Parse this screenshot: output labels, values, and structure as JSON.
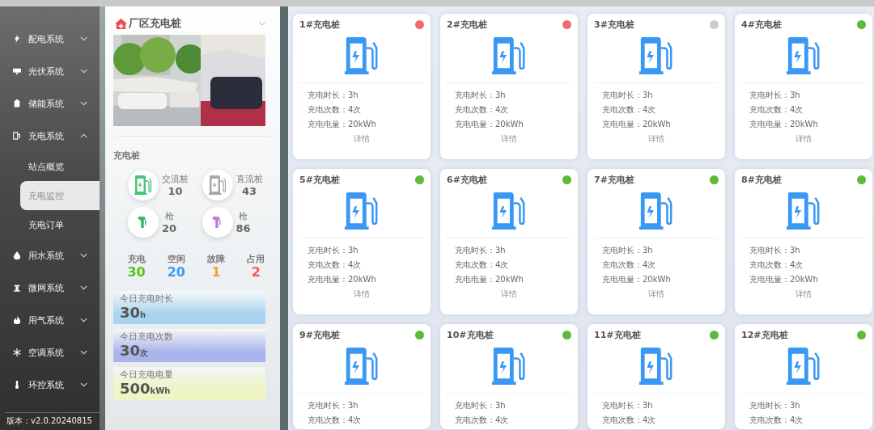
{
  "sidebar": {
    "items": [
      {
        "label": "配电系统",
        "expanded": false
      },
      {
        "label": "光伏系统",
        "expanded": false
      },
      {
        "label": "储能系统",
        "expanded": false
      },
      {
        "label": "充电系统",
        "expanded": true,
        "children": [
          {
            "label": "站点概览",
            "selected": false
          },
          {
            "label": "充电监控",
            "selected": true
          },
          {
            "label": "充电订单",
            "selected": false
          }
        ]
      },
      {
        "label": "用水系统",
        "expanded": false
      },
      {
        "label": "微网系统",
        "expanded": false
      },
      {
        "label": "用气系统",
        "expanded": false
      },
      {
        "label": "空调系统",
        "expanded": false
      },
      {
        "label": "环控系统",
        "expanded": false
      }
    ],
    "version": "版本：v2.0.20240815"
  },
  "station": {
    "title": "厂区充电桩",
    "section": "充电桩",
    "counts": [
      {
        "kind": "charger",
        "label": "交流桩",
        "value": "10",
        "color": "#4cc37a"
      },
      {
        "kind": "charger",
        "label": "直流桩",
        "value": "43",
        "color": "#a8a8a8"
      },
      {
        "kind": "gun",
        "label": "枪",
        "value": "20",
        "color": "#3fb36a"
      },
      {
        "kind": "gun",
        "label": "枪",
        "value": "86",
        "color": "#c27ad8"
      }
    ],
    "statuses": [
      {
        "label": "充电",
        "value": "30",
        "color": "#52c41a"
      },
      {
        "label": "空闲",
        "value": "20",
        "color": "#3a9cf5"
      },
      {
        "label": "故障",
        "value": "1",
        "color": "#f0a030"
      },
      {
        "label": "占用",
        "value": "2",
        "color": "#f05a5a"
      }
    ],
    "today": [
      {
        "label": "今日充电时长",
        "value": "30",
        "unit": "h",
        "color": "#a9d3ee"
      },
      {
        "label": "今日充电次数",
        "value": "30",
        "unit": "次",
        "color": "#aab4ec"
      },
      {
        "label": "今日充电电量",
        "value": "500",
        "unit": "kWh",
        "color": "#eef4c4"
      }
    ]
  },
  "chargers": [
    {
      "name": "1#充电桩",
      "color": "#f26b6b",
      "stats": [
        "充电时长：3h",
        "充电次数：4次",
        "充电电量：20kWh"
      ],
      "link": "详情"
    },
    {
      "name": "2#充电桩",
      "color": "#f26b6b",
      "stats": [
        "充电时长：3h",
        "充电次数：4次",
        "充电电量：20kWh"
      ],
      "link": "详情"
    },
    {
      "name": "3#充电桩",
      "color": "#cccccc",
      "stats": [
        "充电时长：3h",
        "充电次数：4次",
        "充电电量：20kWh"
      ],
      "link": "详情"
    },
    {
      "name": "4#充电桩",
      "color": "#5dbb3a",
      "stats": [
        "充电时长：3h",
        "充电次数：4次",
        "充电电量：20kWh"
      ],
      "link": "详情"
    },
    {
      "name": "5#充电桩",
      "color": "#5dbb3a",
      "stats": [
        "充电时长：3h",
        "充电次数：4次",
        "充电电量：20kWh"
      ],
      "link": "详情"
    },
    {
      "name": "6#充电桩",
      "color": "#5dbb3a",
      "stats": [
        "充电时长：3h",
        "充电次数：4次",
        "充电电量：20kWh"
      ],
      "link": "详情"
    },
    {
      "name": "7#充电桩",
      "color": "#5dbb3a",
      "stats": [
        "充电时长：3h",
        "充电次数：4次",
        "充电电量：20kWh"
      ],
      "link": "详情"
    },
    {
      "name": "8#充电桩",
      "color": "#5dbb3a",
      "stats": [
        "充电时长：3h",
        "充电次数：4次",
        "充电电量：20kWh"
      ],
      "link": "详情"
    },
    {
      "name": "9#充电桩",
      "color": "#5dbb3a",
      "stats": [
        "充电时长：3h",
        "充电次数：4次"
      ]
    },
    {
      "name": "10#充电桩",
      "color": "#5dbb3a",
      "stats": [
        "充电时长：3h",
        "充电次数：4次"
      ]
    },
    {
      "name": "11#充电桩",
      "color": "#5dbb3a",
      "stats": [
        "充电时长：3h",
        "充电次数：4次"
      ]
    },
    {
      "name": "12#充电桩",
      "color": "#5dbb3a",
      "stats": [
        "充电时长：3h",
        "充电次数：4次"
      ]
    }
  ]
}
